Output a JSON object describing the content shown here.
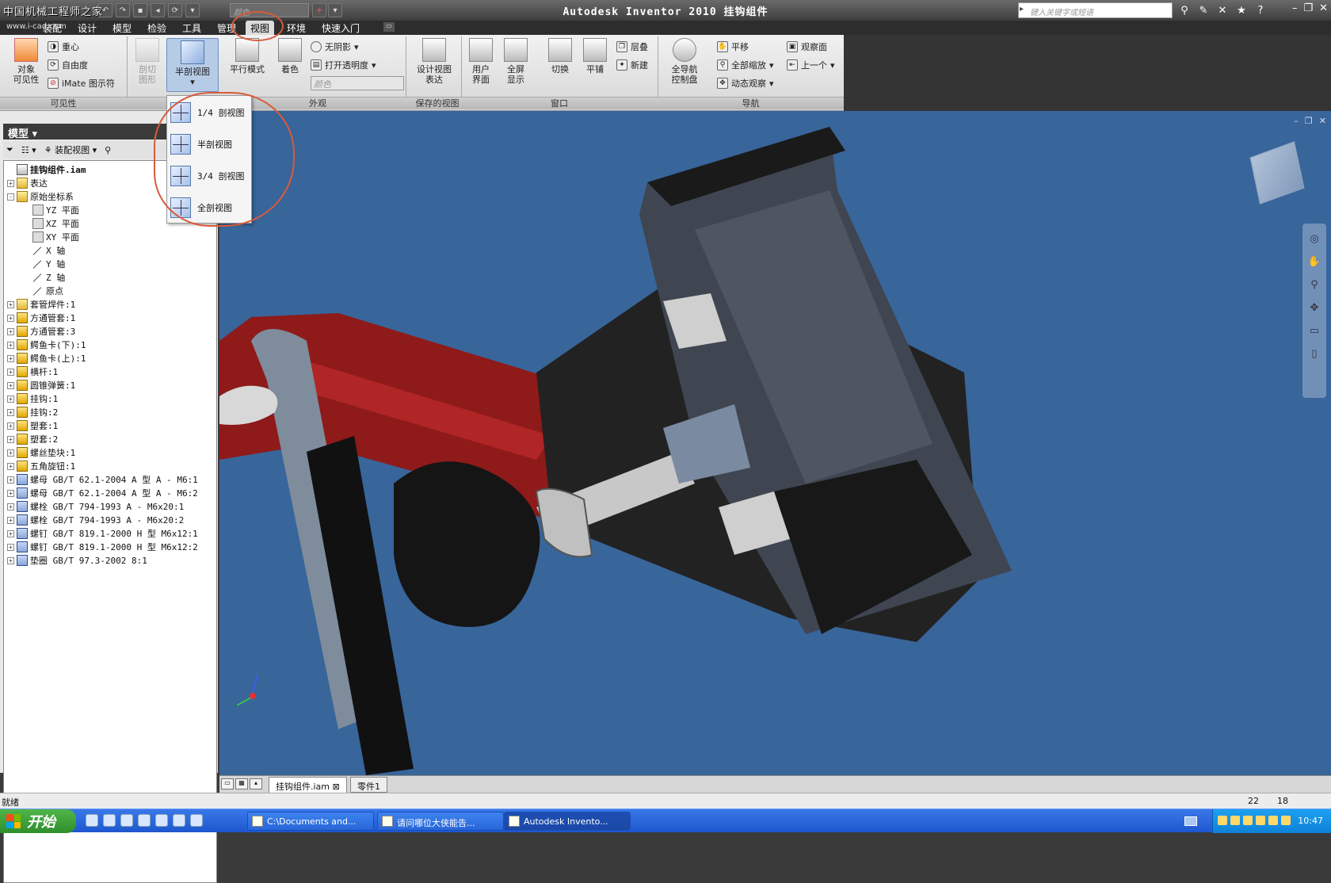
{
  "app": {
    "title": "Autodesk Inventor 2010  挂钩组件",
    "watermark": "中国机械工程师之家",
    "watermark_url": "www.i-cad.com",
    "qat_color_placeholder": "颜色",
    "search_placeholder": "键入关键字或短语"
  },
  "tabs": [
    {
      "label": "装配"
    },
    {
      "label": "设计"
    },
    {
      "label": "模型"
    },
    {
      "label": "检验"
    },
    {
      "label": "工具"
    },
    {
      "label": "管理"
    },
    {
      "label": "视图"
    },
    {
      "label": "环境"
    },
    {
      "label": "快速入门"
    }
  ],
  "ribbon": {
    "visibility": {
      "label": "可见性",
      "object_visibility": "对象\n可见性",
      "center": "重心",
      "dof": "自由度",
      "imate": "iMate 图示符"
    },
    "appearance": {
      "label": "外观",
      "section_shape": "剖切\n图形",
      "half_section": "半剖视图",
      "parallel_mode": "平行模式",
      "shading": "着色",
      "no_shadow": "无阴影",
      "transparency": "打开透明度",
      "color_placeholder": "颜色"
    },
    "saved_views": {
      "label": "保存的视图",
      "design_view": "设计视图\n表达"
    },
    "window": {
      "label": "窗口",
      "user_interface": "用户\n界面",
      "fullscreen": "全屏\n显示",
      "switch": "切换",
      "tile": "平铺",
      "cascade": "层叠",
      "new": "新建"
    },
    "navigation": {
      "label": "导航",
      "steering_wheel": "全导航\n控制盘",
      "pan": "平移",
      "zoom_all": "全部缩放",
      "orbit": "动态观察",
      "look_at": "观察面",
      "previous": "上一个"
    }
  },
  "section_menu": [
    {
      "label": "1/4 剖视图"
    },
    {
      "label": "半剖视图"
    },
    {
      "label": "3/4 剖视图"
    },
    {
      "label": "全剖视图"
    }
  ],
  "browser": {
    "title": "模型",
    "view_mode": "装配视图",
    "nodes": [
      {
        "label": "挂钩组件.iam",
        "icon": "doc-icon",
        "level": 0,
        "exp": ""
      },
      {
        "label": "表达",
        "icon": "folder-icon",
        "level": 0,
        "exp": "+"
      },
      {
        "label": "原始坐标系",
        "icon": "folder-icon",
        "level": 0,
        "exp": "-"
      },
      {
        "label": "YZ 平面",
        "icon": "plane-icon",
        "level": 2,
        "exp": ""
      },
      {
        "label": "XZ 平面",
        "icon": "plane-icon",
        "level": 2,
        "exp": ""
      },
      {
        "label": "XY 平面",
        "icon": "plane-icon",
        "level": 2,
        "exp": ""
      },
      {
        "label": "X 轴",
        "icon": "axis-icon",
        "level": 2,
        "exp": ""
      },
      {
        "label": "Y 轴",
        "icon": "axis-icon",
        "level": 2,
        "exp": ""
      },
      {
        "label": "Z 轴",
        "icon": "axis-icon",
        "level": 2,
        "exp": ""
      },
      {
        "label": "原点",
        "icon": "axis-icon",
        "level": 2,
        "exp": ""
      },
      {
        "label": "套管焊件:1",
        "icon": "assembly-icon",
        "level": 0,
        "exp": "+"
      },
      {
        "label": "方通管套:1",
        "icon": "part-icon",
        "level": 0,
        "exp": "+"
      },
      {
        "label": "方通管套:3",
        "icon": "part-icon",
        "level": 0,
        "exp": "+"
      },
      {
        "label": "鳄鱼卡(下):1",
        "icon": "part-icon",
        "level": 0,
        "exp": "+"
      },
      {
        "label": "鳄鱼卡(上):1",
        "icon": "part-icon",
        "level": 0,
        "exp": "+"
      },
      {
        "label": "横杆:1",
        "icon": "part-icon",
        "level": 0,
        "exp": "+"
      },
      {
        "label": "圆锥弹簧:1",
        "icon": "part-icon",
        "level": 0,
        "exp": "+"
      },
      {
        "label": "挂钩:1",
        "icon": "part-icon",
        "level": 0,
        "exp": "+"
      },
      {
        "label": "挂钩:2",
        "icon": "part-icon",
        "level": 0,
        "exp": "+"
      },
      {
        "label": "塑套:1",
        "icon": "part-icon",
        "level": 0,
        "exp": "+"
      },
      {
        "label": "塑套:2",
        "icon": "part-icon",
        "level": 0,
        "exp": "+"
      },
      {
        "label": "螺丝垫块:1",
        "icon": "part-icon",
        "level": 0,
        "exp": "+"
      },
      {
        "label": "五角旋钮:1",
        "icon": "part-icon",
        "level": 0,
        "exp": "+"
      },
      {
        "label": "螺母 GB/T 62.1-2004 A 型 A - M6:1",
        "icon": "bolt-icon",
        "level": 0,
        "exp": "+"
      },
      {
        "label": "螺母 GB/T 62.1-2004 A 型 A - M6:2",
        "icon": "bolt-icon",
        "level": 0,
        "exp": "+"
      },
      {
        "label": "螺栓 GB/T 794-1993 A - M6x20:1",
        "icon": "bolt-icon",
        "level": 0,
        "exp": "+"
      },
      {
        "label": "螺栓 GB/T 794-1993 A - M6x20:2",
        "icon": "bolt-icon",
        "level": 0,
        "exp": "+"
      },
      {
        "label": "螺钉 GB/T 819.1-2000 H 型 M6x12:1",
        "icon": "bolt-icon",
        "level": 0,
        "exp": "+"
      },
      {
        "label": "螺钉 GB/T 819.1-2000 H 型 M6x12:2",
        "icon": "bolt-icon",
        "level": 0,
        "exp": "+"
      },
      {
        "label": "垫圈 GB/T 97.3-2002 8:1",
        "icon": "bolt-icon",
        "level": 0,
        "exp": "+"
      }
    ]
  },
  "doc_tabs": [
    {
      "label": "挂钩组件.iam"
    },
    {
      "label": "零件1"
    }
  ],
  "status": {
    "text": "就绪",
    "n1": "22",
    "n2": "18"
  },
  "taskbar": {
    "start": "开始",
    "tasks": [
      {
        "label": "C:\\Documents and..."
      },
      {
        "label": "请问哪位大侠能告..."
      },
      {
        "label": "Autodesk Invento..."
      }
    ],
    "clock": "10:47"
  },
  "colors": {
    "viewport_bg": "#38659a",
    "annotation": "#d95a3a",
    "red_part": "#8e1a1a"
  }
}
